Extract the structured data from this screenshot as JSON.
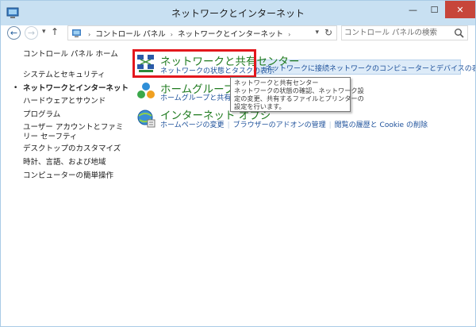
{
  "window": {
    "title": "ネットワークとインターネット",
    "controls": {
      "minimize": "—",
      "maximize": "☐",
      "close": "✕"
    }
  },
  "address_bar": {
    "breadcrumbs": [
      "コントロール パネル",
      "ネットワークとインターネット"
    ],
    "search_placeholder": "コントロール パネルの検索"
  },
  "sidebar": {
    "items": [
      {
        "label": "コントロール パネル ホーム"
      },
      {
        "label": "システムとセキュリティ"
      },
      {
        "label": "ネットワークとインターネット",
        "current": true
      },
      {
        "label": "ハードウェアとサウンド"
      },
      {
        "label": "プログラム"
      },
      {
        "label": "ユーザー アカウントとファミリー セーフティ"
      },
      {
        "label": "デスクトップのカスタマイズ"
      },
      {
        "label": "時計、言語、および地域"
      },
      {
        "label": "コンピューターの簡単操作"
      }
    ]
  },
  "categories": [
    {
      "title": "ネットワークと共有センター",
      "icon": "network-sharing-center-icon",
      "links": [
        "ネットワークの状態とタスクの表示",
        "ネットワークに接続",
        "ネットワークのコンピューターとデバイスの表示"
      ]
    },
    {
      "title": "ホームグループ",
      "icon": "homegroup-icon",
      "links": [
        "ホームグループと共有に関"
      ]
    },
    {
      "title": "インターネット オプション",
      "title_visible": "インターネット オプシ",
      "icon": "internet-options-icon",
      "links": [
        "ホームページの変更",
        "ブラウザーのアドオンの管理",
        "閲覧の履歴と Cookie の削除"
      ]
    }
  ],
  "tooltip": {
    "lines": [
      "ネットワークと共有センター",
      "ネットワークの状態の確認、ネットワーク設",
      "定の変更、共有するファイルとプリンターの",
      "設定を行います。"
    ]
  },
  "colors": {
    "titlebar": "#c8e0f2",
    "close_button": "#c7453a",
    "category_title": "#1e7a1e",
    "link": "#1b4f9a",
    "highlight": "#ddebf8",
    "callout_box": "#e3171d"
  }
}
